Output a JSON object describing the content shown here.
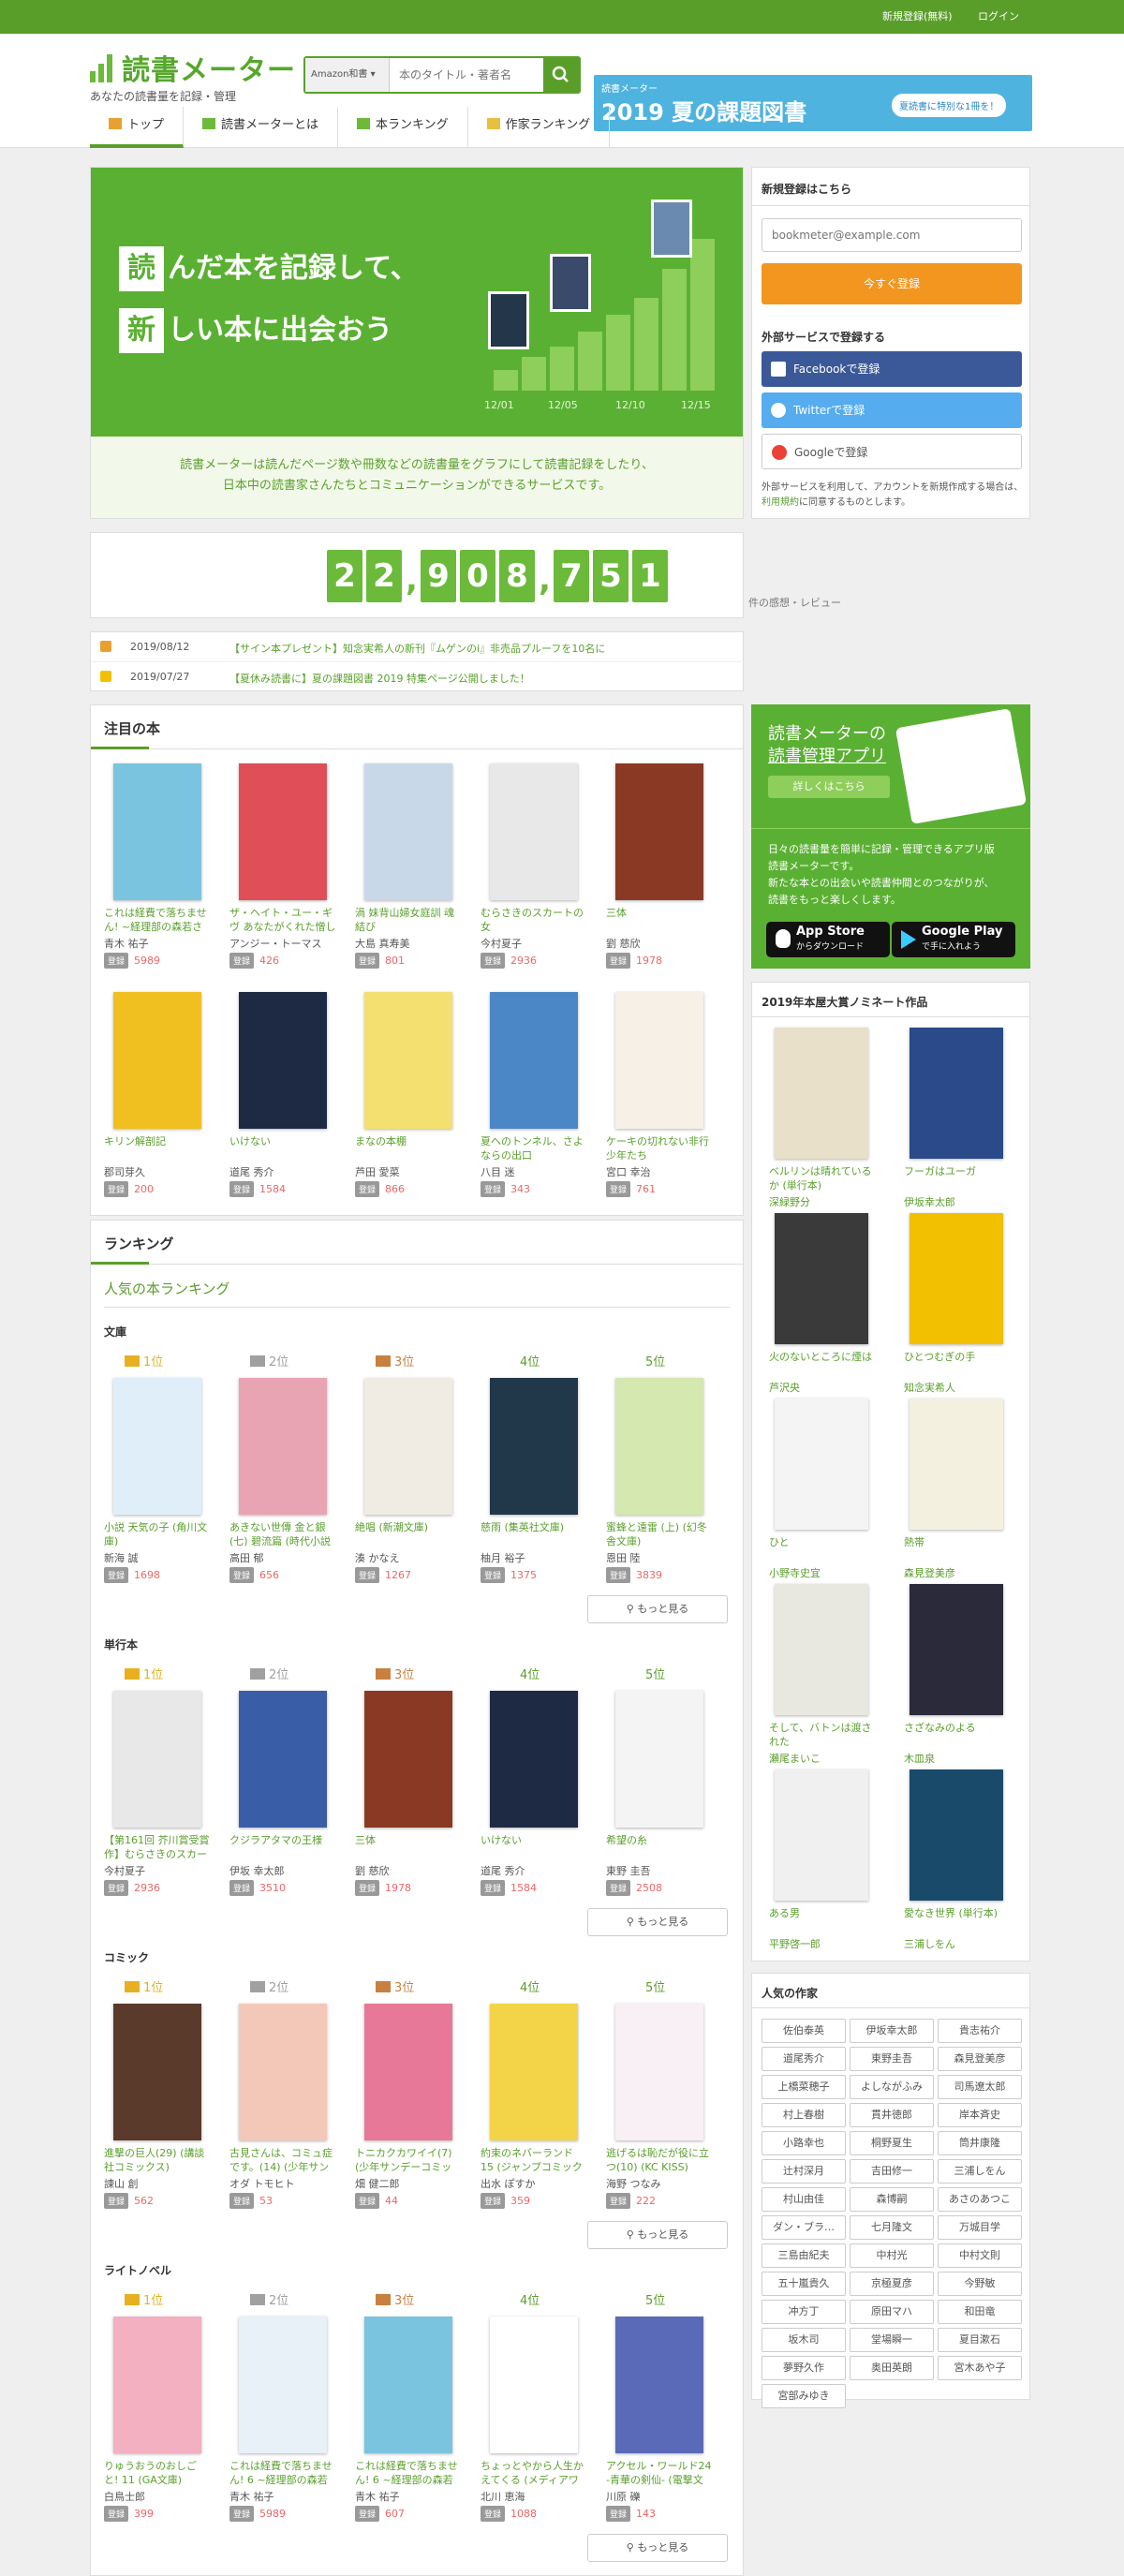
{
  "topbar": {
    "register": "新規登録(無料)",
    "login": "ログイン"
  },
  "logo": {
    "title": "読書メーター",
    "subtitle": "あなたの読書量を記録・管理"
  },
  "search": {
    "category": "Amazon和書 ▾",
    "placeholder": "本のタイトル・著者名"
  },
  "banner": {
    "year": "読書メーター",
    "main": "2019 夏の課題図書",
    "cta": "夏読書に特別な1冊を！"
  },
  "nav": [
    "トップ",
    "読書メーターとは",
    "本ランキング",
    "作家ランキング"
  ],
  "hero": {
    "line1_box": "読",
    "line1": "んだ本を記録して、",
    "line2_box": "新",
    "line2": "しい本に出会おう",
    "desc1": "読書メーターは読んだページ数や冊数などの読書量をグラフにして読書記録をしたり、",
    "desc2": "日本中の読書家さんたちとコミュニケーションができるサービスです。",
    "ticks": [
      "12/01",
      "12/05",
      "12/10",
      "12/15"
    ],
    "chart_bars": [
      0.12,
      0.2,
      0.26,
      0.35,
      0.45,
      0.55,
      0.72,
      0.9
    ]
  },
  "counter": {
    "digits": [
      "2",
      "2",
      ",",
      "9",
      "0",
      "8",
      ",",
      "7",
      "5",
      "1"
    ],
    "label": "件の感想・レビュー"
  },
  "news": [
    {
      "date": "2019/08/12",
      "text": "【サイン本プレゼント】知念実希人の新刊『ムゲンのi』非売品プルーフを10名に",
      "color": "#e8a030"
    },
    {
      "date": "2019/07/27",
      "text": "【夏休み読書に】夏の課題図書 2019 特集ページ公開しました！",
      "color": "#f3c000"
    }
  ],
  "featured": {
    "title": "注目の本",
    "books": [
      {
        "title": "これは経費で落ちません! ~経理部の森若さん",
        "author": "青木 祐子",
        "count": "5989",
        "color": "#7ac4e0"
      },
      {
        "title": "ザ・ヘイト・ユー・ギヴ あなたがくれた憎し",
        "author": "アンジー・トーマス",
        "count": "426",
        "color": "#e04f57"
      },
      {
        "title": "渦 妹背山婦女庭訓 魂結び",
        "author": "大島 真寿美",
        "count": "801",
        "color": "#c8d8e8"
      },
      {
        "title": "むらさきのスカートの女",
        "author": "今村夏子",
        "count": "2936",
        "color": "#e8e8e8"
      },
      {
        "title": "三体",
        "author": "劉 慈欣",
        "count": "1978",
        "color": "#8a3a24"
      },
      {
        "title": "キリン解剖記",
        "author": "郡司芽久",
        "count": "200",
        "color": "#f0c020"
      },
      {
        "title": "いけない",
        "author": "道尾 秀介",
        "count": "1584",
        "color": "#1e2a44"
      },
      {
        "title": "まなの本棚",
        "author": "芦田 愛菜",
        "count": "866",
        "color": "#f3e070"
      },
      {
        "title": "夏へのトンネル、さよならの出口",
        "author": "八目 迷",
        "count": "343",
        "color": "#4b87c7"
      },
      {
        "title": "ケーキの切れない非行少年たち",
        "author": "宮口 幸治",
        "count": "761",
        "color": "#f6f0e6"
      }
    ]
  },
  "ranking": {
    "title": "ランキング",
    "subtitle": "人気の本ランキング",
    "register_label": "登録",
    "more": "もっと見る",
    "ranks": [
      "1位",
      "2位",
      "3位",
      "4位",
      "5位"
    ],
    "categories": [
      {
        "name": "文庫",
        "books": [
          {
            "title": "小説 天気の子 (角川文庫)",
            "author": "新海 誠",
            "count": "1698",
            "color": "#dfeef8"
          },
          {
            "title": "あきない世傳 金と銀 (七) 碧流篇 (時代小説",
            "author": "高田 郁",
            "count": "656",
            "color": "#e9a4b4"
          },
          {
            "title": "絶唱 (新潮文庫)",
            "author": "湊 かなえ",
            "count": "1267",
            "color": "#f0ece4"
          },
          {
            "title": "慈雨 (集英社文庫)",
            "author": "柚月 裕子",
            "count": "1375",
            "color": "#20384a"
          },
          {
            "title": "蜜蜂と遠雷 (上) (幻冬舎文庫)",
            "author": "恩田 陸",
            "count": "3839",
            "color": "#d4e8b0"
          }
        ]
      },
      {
        "name": "単行本",
        "books": [
          {
            "title": "【第161回 芥川賞受賞作】むらさきのスカー",
            "author": "今村夏子",
            "count": "2936",
            "color": "#e8e8e8"
          },
          {
            "title": "クジラアタマの王様",
            "author": "伊坂 幸太郎",
            "count": "3510",
            "color": "#3a5da8"
          },
          {
            "title": "三体",
            "author": "劉 慈欣",
            "count": "1978",
            "color": "#8a3a24"
          },
          {
            "title": "いけない",
            "author": "道尾 秀介",
            "count": "1584",
            "color": "#1e2a44"
          },
          {
            "title": "希望の糸",
            "author": "東野 圭吾",
            "count": "2508",
            "color": "#f4f4f4"
          }
        ]
      },
      {
        "name": "コミック",
        "books": [
          {
            "title": "進撃の巨人(29) (講談社コミックス)",
            "author": "諫山 創",
            "count": "562",
            "color": "#5a3a2a"
          },
          {
            "title": "古見さんは、コミュ症です。(14) (少年サン",
            "author": "オダ トモヒト",
            "count": "53",
            "color": "#f4c8b8"
          },
          {
            "title": "トニカクカワイイ(7) (少年サンデーコミック",
            "author": "畑 健二郎",
            "count": "44",
            "color": "#e87898"
          },
          {
            "title": "約束のネバーランド 15 (ジャンプコミック",
            "author": "出水 ぽすか",
            "count": "359",
            "color": "#f3d448"
          },
          {
            "title": "逃げるは恥だが役に立つ(10) (KC KISS)",
            "author": "海野 つなみ",
            "count": "222",
            "color": "#f8f0f4"
          }
        ]
      },
      {
        "name": "ライトノベル",
        "books": [
          {
            "title": "りゅうおうのおしごと! 11 (GA文庫)",
            "author": "白鳥士郎",
            "count": "399",
            "color": "#f3b0c0"
          },
          {
            "title": "これは経費で落ちません! 6 ~経理部の森若さ",
            "author": "青木 祐子",
            "count": "5989",
            "color": "#e8f0f8"
          },
          {
            "title": "これは経費で落ちません! 6 ~経理部の森若さ",
            "author": "青木 祐子",
            "count": "607",
            "color": "#7ac4e0"
          },
          {
            "title": "ちょっとやから人生かえてくる (メディアワ",
            "author": "北川 恵海",
            "count": "1088",
            "color": "#ffffff"
          },
          {
            "title": "アクセル・ワールド24 -青華の剣仙- (電撃文",
            "author": "川原 礫",
            "count": "143",
            "color": "#5a6ab8"
          }
        ]
      }
    ]
  },
  "signup": {
    "title": "新規登録はこちら",
    "email_placeholder": "bookmeter@example.com",
    "submit": "今すぐ登録",
    "sns_title": "外部サービスで登録する",
    "facebook": "Facebookで登録",
    "twitter": "Twitterで登録",
    "google": "Googleで登録",
    "terms_pre": "外部サービスを利用して、アカウントを新規作成する場合は、",
    "terms_link": "利用規約",
    "terms_post": "に同意するものとします。"
  },
  "app": {
    "title1": "読書メーターの",
    "title2": "読書管理アプリ",
    "more": "詳しくはこちら",
    "desc1": "日々の読書量を簡単に記録・管理できるアプリ版",
    "desc2": "読書メーターです。",
    "desc3": "新たな本との出会いや読書仲間とのつながりが、",
    "desc4": "読書をもっと楽しくします。",
    "appstore_small": "App Store",
    "appstore_big": "からダウンロード",
    "google_small": "Google Play",
    "google_big": "で手に入れよう"
  },
  "award": {
    "title": "2019年本屋大賞ノミネート作品",
    "books": [
      {
        "title": "ベルリンは晴れているか (単行本)",
        "author": "深緑野分",
        "color": "#e8e0c8"
      },
      {
        "title": "フーガはユーガ",
        "author": "伊坂幸太郎",
        "color": "#2a4a8a"
      },
      {
        "title": "火のないところに煙は",
        "author": "芦沢央",
        "color": "#3a3a3a"
      },
      {
        "title": "ひとつむぎの手",
        "author": "知念実希人",
        "color": "#f3c000"
      },
      {
        "title": "ひと",
        "author": "小野寺史宜",
        "color": "#f4f4f4"
      },
      {
        "title": "熱帯",
        "author": "森見登美彦",
        "color": "#f4f0e0"
      },
      {
        "title": "そして、バトンは渡された",
        "author": "瀬尾まいこ",
        "color": "#e8e8e0"
      },
      {
        "title": "さざなみのよる",
        "author": "木皿泉",
        "color": "#2a2a3a"
      },
      {
        "title": "ある男",
        "author": "平野啓一郎",
        "color": "#f0f0f0"
      },
      {
        "title": "愛なき世界 (単行本)",
        "author": "三浦しをん",
        "color": "#1a4a6a"
      }
    ]
  },
  "authors": {
    "title": "人気の作家",
    "names": [
      "佐伯泰英",
      "伊坂幸太郎",
      "貴志祐介",
      "道尾秀介",
      "東野圭吾",
      "森見登美彦",
      "上橋菜穂子",
      "よしながふみ",
      "司馬遼太郎",
      "村上春樹",
      "貫井徳郎",
      "岸本斉史",
      "小路幸也",
      "桐野夏生",
      "筒井康隆",
      "辻村深月",
      "吉田修一",
      "三浦しをん",
      "村山由佳",
      "森博嗣",
      "あさのあつこ",
      "ダン・ブラ…",
      "七月隆文",
      "万城目学",
      "三島由紀夫",
      "中村光",
      "中村文則",
      "五十嵐貴久",
      "京極夏彦",
      "今野敏",
      "冲方丁",
      "原田マハ",
      "和田竜",
      "坂木司",
      "堂場瞬一",
      "夏目漱石",
      "夢野久作",
      "奥田英朗",
      "宮木あや子",
      "宮部みゆき"
    ]
  },
  "colors": {
    "brand": "#5a9e2a",
    "accent": "#f39620",
    "facebook": "#3b5998",
    "twitter": "#55acee"
  }
}
